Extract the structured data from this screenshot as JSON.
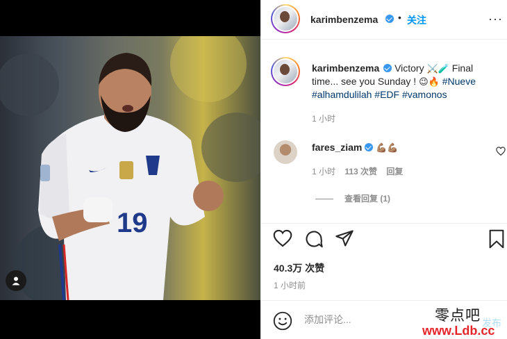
{
  "post": {
    "author": "karimbenzema",
    "follow_label": "关注",
    "separator": "•",
    "more_label": "···",
    "caption_text_1": "Victory ",
    "caption_emoji_1": "⚔️🧪",
    "caption_text_2": " Final time... see you Sunday ! ",
    "caption_emoji_2": "😉🔥",
    "hashtags": [
      "#Nueve",
      "#alhamdulilah",
      "#EDF",
      "#vamonos"
    ],
    "caption_time": "1 小时",
    "likes": "40.3万 次赞",
    "posted_ago": "1 小时前"
  },
  "photo": {
    "jersey_number": "19"
  },
  "comment": {
    "user": "fares_ziam",
    "emoji": "💪🏽💪🏽",
    "time": "1 小时",
    "likes": "113 次赞",
    "reply_label": "回复",
    "view_replies": "查看回复 (1)"
  },
  "add_comment": {
    "placeholder": "添加评论...",
    "post_label": "发布"
  },
  "watermark": {
    "zh": "零点吧",
    "url": "www.Ldb.cc"
  },
  "icons": {
    "like": "heart-icon",
    "comment": "comment-bubble-icon",
    "share": "paper-plane-icon",
    "save": "bookmark-icon",
    "emoji": "smiley-icon",
    "tag": "user-tag-icon"
  },
  "colors": {
    "link_blue": "#0095f6",
    "hashtag": "#00376b",
    "muted": "#8e8e8e",
    "watermark_red": "#e5252a"
  }
}
